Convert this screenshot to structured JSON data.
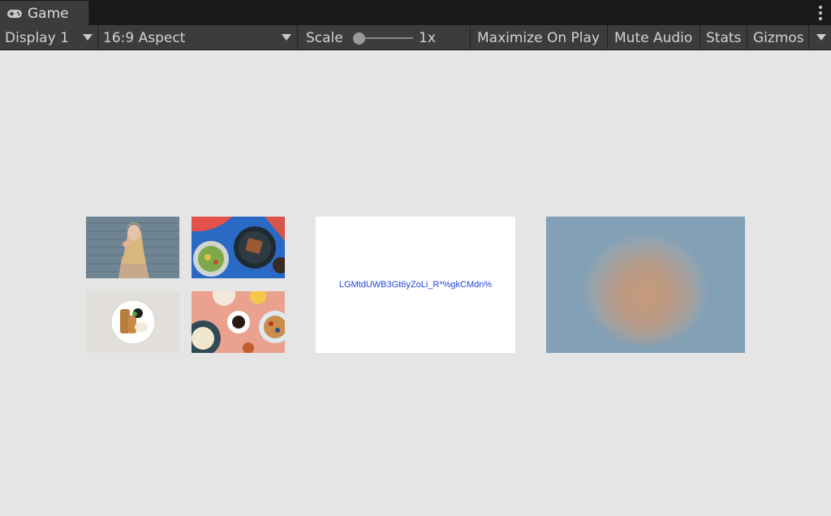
{
  "tab": {
    "label": "Game",
    "icon": "gamepad-icon"
  },
  "toolbar": {
    "display": "Display 1",
    "aspect": "16:9 Aspect",
    "scale_label": "Scale",
    "scale_value": "1x",
    "maximize": "Maximize On Play",
    "mute": "Mute Audio",
    "stats": "Stats",
    "gizmos": "Gizmos"
  },
  "game": {
    "hash_text": "LGMtdUWB3Gt6yZoLi_R*%gkCMdn%",
    "images": [
      "woman-eating-photo",
      "food-plate-blue-photo",
      "waffles-plate-photo",
      "coffee-breakfast-photo"
    ]
  },
  "colors": {
    "background": "#e5e5e5",
    "toolbar": "#3c3c3c",
    "hash_text": "#2244dd"
  }
}
